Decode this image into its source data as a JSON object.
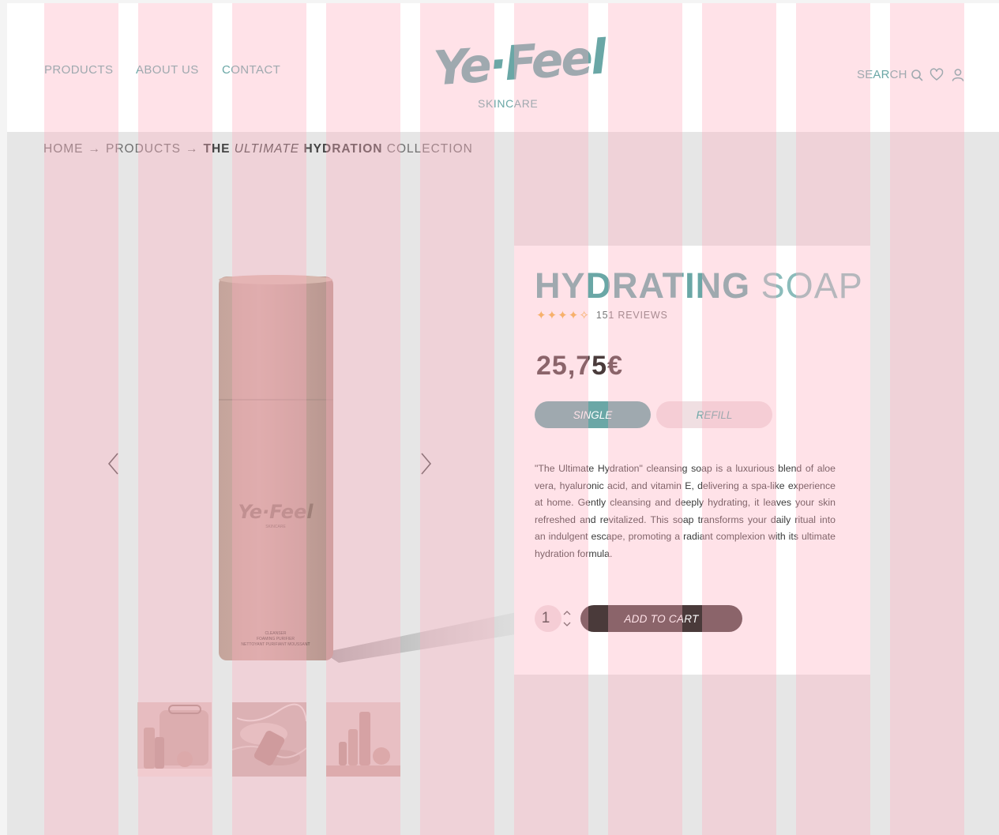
{
  "brand": {
    "logo_text": "Ye·Feel",
    "logo_sub": "SKINCARE"
  },
  "nav": {
    "items": [
      "PRODUCTS",
      "ABOUT US",
      "CONTACT"
    ]
  },
  "header_actions": {
    "search_label": "SEARCH",
    "icons": [
      "search-icon",
      "heart-icon",
      "user-icon"
    ]
  },
  "breadcrumb": {
    "items": [
      "HOME",
      "PRODUCTS"
    ],
    "separator": "→",
    "current": {
      "pre": "THE",
      "italic": "ULTIMATE",
      "bold": "HYDRATION",
      "post": "COLLECTION"
    }
  },
  "gallery": {
    "main_image": "pink-cylinder-cleanser-bottle",
    "bottle_logo": "Ye·Feel",
    "bottle_sub": "SKINCARE",
    "bottle_label": [
      "CLEANSER",
      "FOAMING PURIFIER",
      "NETTOYANT PURIFIANT MOUSSANT"
    ],
    "thumbnails": [
      "product-set-with-bag",
      "bottle-in-water",
      "product-lineup"
    ]
  },
  "product": {
    "title_bold": "HYDRATING",
    "title_light": "SOAP",
    "rating": 4,
    "rating_max": 5,
    "reviews_label": "151 REVIEWS",
    "price": "25,75€",
    "options": [
      "SINGLE",
      "REFILL"
    ],
    "selected_option": "SINGLE",
    "description": "\"The Ultimate Hydration\" cleansing soap is a luxurious blend of aloe vera, hyaluronic acid, and vitamin E, delivering a spa-like experience at home. Gently cleansing and deeply hydrating, it leaves your skin refreshed and revitalized. This soap transforms your daily ritual into an indulgent escape, promoting a radiant complexion with its ultimate hydration formula.",
    "quantity": "1",
    "add_to_cart_label": "ADD TO CART"
  },
  "colors": {
    "accent_teal": "#6aa7a6",
    "dark_brown": "#4a3a3a",
    "pink_light": "#f0dfe2",
    "star": "#f2b33d",
    "grid_overlay": "#ffb0c0"
  }
}
